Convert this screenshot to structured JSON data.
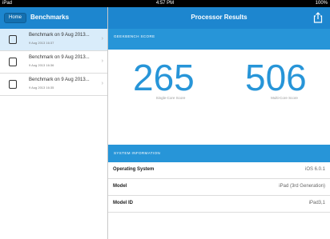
{
  "status": {
    "left": "iPad",
    "time": "4:57 PM",
    "battery": "100%"
  },
  "sidebar": {
    "home_label": "Home",
    "title": "Benchmarks",
    "items": [
      {
        "title": "Benchmark on 9 Aug 2013...",
        "subtitle": "9 Aug 2013 16:37",
        "selected": true
      },
      {
        "title": "Benchmark on 9 Aug 2013...",
        "subtitle": "9 Aug 2013 16:36",
        "selected": false
      },
      {
        "title": "Benchmark on 9 Aug 2013...",
        "subtitle": "9 Aug 2013 16:35",
        "selected": false
      }
    ]
  },
  "main": {
    "title": "Processor Results",
    "geekbench_label": "GEEKBENCH SCORE",
    "single_score": "265",
    "single_label": "Single-Core Score",
    "multi_score": "506",
    "multi_label": "Multi-Core Score",
    "system_label": "SYSTEM INFORMATION",
    "rows": [
      {
        "key": "Operating System",
        "value": "iOS 6.0.1"
      },
      {
        "key": "Model",
        "value": "iPad (3rd Generation)"
      },
      {
        "key": "Model ID",
        "value": "iPad3,1"
      }
    ]
  },
  "colors": {
    "accent": "#1d86cf",
    "score": "#2795d8"
  }
}
